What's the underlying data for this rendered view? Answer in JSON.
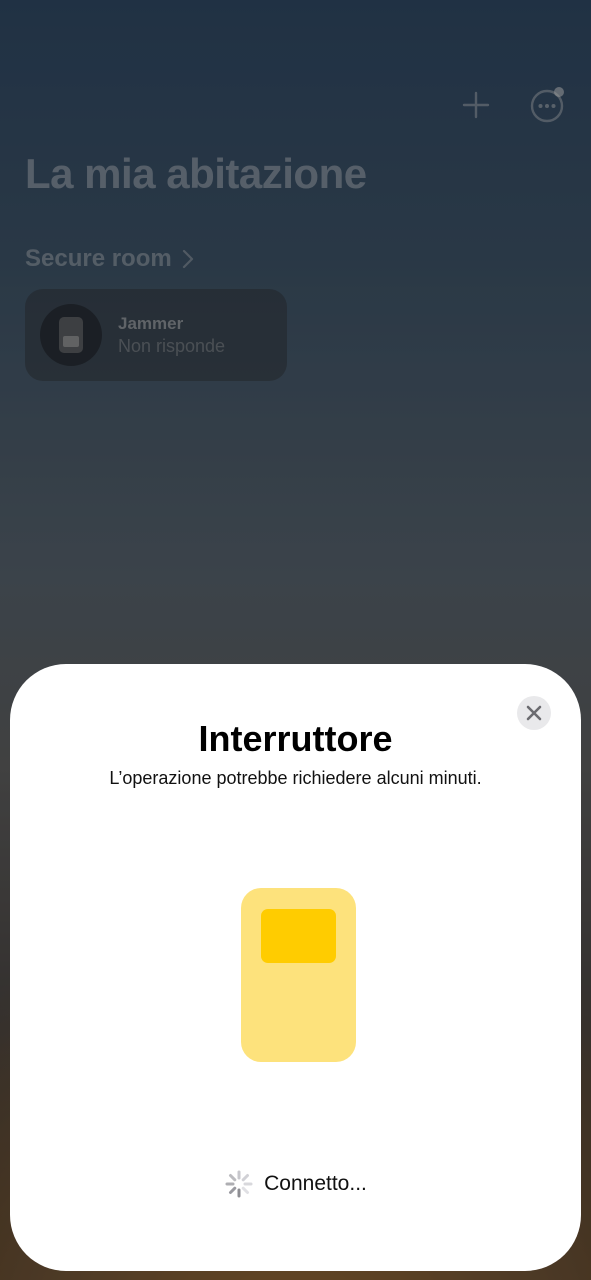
{
  "header": {
    "title": "La mia abitazione",
    "add_icon": "plus-icon",
    "more_icon": "more-ellipsis-icon"
  },
  "room": {
    "label": "Secure room",
    "chevron_icon": "chevron-right-icon"
  },
  "device": {
    "name": "Jammer",
    "status": "Non risponde",
    "icon": "switch-icon"
  },
  "sheet": {
    "title": "Interruttore",
    "subtitle": "L’operazione potrebbe richiedere alcuni minuti.",
    "close_icon": "close-icon",
    "illustration": "switch-illustration",
    "connecting_label": "Connetto...",
    "spinner_icon": "spinner-icon"
  },
  "colors": {
    "switch_body": "#fde27c",
    "switch_rocker": "#ffcc00",
    "sheet_background": "#ffffff"
  }
}
